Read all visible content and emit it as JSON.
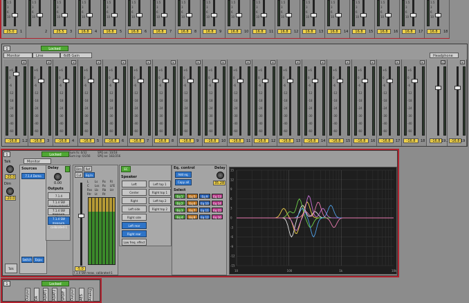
{
  "top_strip": {
    "values": [
      "25.0",
      "",
      "25.5",
      "16.8",
      "16.8",
      "16.8",
      "16.8",
      "16.8",
      "16.8",
      "16.8",
      "16.8",
      "16.8",
      "16.8",
      "16.8",
      "16.8",
      "16.8",
      "16.8",
      "16.8",
      "16.8"
    ],
    "channels": [
      "1",
      "2",
      "3",
      "4",
      "5",
      "6",
      "7",
      "8",
      "9",
      "10",
      "11",
      "12",
      "13",
      "14",
      "15",
      "16",
      "17",
      "18"
    ],
    "scale": [
      "1.5",
      "3",
      "6",
      "10"
    ]
  },
  "monitor_section": {
    "index": "1",
    "locked": "Locked",
    "tabs": [
      "Monitor",
      "Line",
      "6dB Gain"
    ],
    "headphone_tab": "Headphone",
    "mute_label": "M",
    "solo_label": "SD",
    "scale": [
      "+6",
      "0",
      "-6",
      "-12",
      "-18",
      "-24",
      "-30",
      "-40",
      "-60"
    ],
    "channel_values": [
      "-16.8",
      "-16.8",
      "-16.8",
      "-16.8",
      "-16.8",
      "-16.8",
      "-16.8",
      "-16.8",
      "-16.8",
      "-16.8",
      "-16.8",
      "-16.8",
      "-16.8",
      "-16.8",
      "-16.8",
      "-16.8",
      "-16.8"
    ],
    "channel_labels": [
      "1.2",
      "3",
      "4",
      "5",
      "6",
      "7",
      "8",
      "9",
      "10",
      "11",
      "12",
      "13",
      "14",
      "15",
      "16",
      "17",
      "18"
    ],
    "headphone_values": [
      "-16.8",
      "-16.8"
    ],
    "headphone_labels": [
      "19.20",
      "19"
    ]
  },
  "speaker_section": {
    "index": "1",
    "locked": "Locked",
    "sum_info_1": "Sum fx: 0/32",
    "sum_info_2": "Sum inp: 0/256",
    "spq_info_1": "SPQ on: 10/18",
    "spq_info_2": "SPQ av: 182/256",
    "monitor_tab": "Monitor",
    "talk": {
      "label": "Talk",
      "value": "-20.0",
      "button": "Talk"
    },
    "dim": {
      "label": "Dim",
      "value": "-20.0"
    },
    "sources": {
      "title": "Sources",
      "item": "7.1.4 Demo"
    },
    "delay_small": {
      "label": "Delay",
      "value": "0.00"
    },
    "outputs": {
      "title": "Outputs",
      "items": [
        "7.1.4",
        "7.1.4 SW measurement",
        "7.1.4 SW measure. calibrated",
        "7.1.4 SW measure. calibrated-1"
      ]
    },
    "switch_btn": "Switch",
    "expand_btn": "Exp⇔",
    "meter_head": [
      "Dim",
      "Ref",
      "Cut",
      "Eq.In"
    ],
    "meter_channels": [
      "L",
      "Ls",
      "Rs",
      "Rl",
      "C",
      "Lss",
      "Rs",
      "LFE",
      "Rss",
      "Lb",
      "Rb",
      "Ltr",
      "Rtr",
      "Lt",
      "Rt"
    ],
    "fader_value": "-5.0",
    "output_name": "7.1.4 SW meas. calibrated-1",
    "ec_label": "EC",
    "speaker": {
      "title": "Speaker",
      "left_col": [
        "Left",
        "Center",
        "Right",
        "Left side",
        "Right side",
        "Left rear",
        "Right rear",
        "Low freq. effect"
      ],
      "right_col": [
        "Left top 1",
        "Right top 1",
        "Left top 2",
        "Right top 2"
      ]
    },
    "eq_control": {
      "title": "Eq. control",
      "add": "Add eq.",
      "copy": "Copy all",
      "select": "Select"
    },
    "eq_buttons": [
      "Eq 1",
      "Eq 5",
      "Eq 9",
      "Eq 13",
      "Eq 2",
      "Eq 6",
      "Eq 10",
      "Eq 14",
      "Eq 3",
      "Eq 7",
      "Eq 11",
      "Eq 15",
      "Eq 4",
      "Eq 8",
      "Eq 12",
      "Eq 16"
    ],
    "eq_colors": [
      "#4b9a3a",
      "#c07a28",
      "#2d64b8",
      "#b73a8a",
      "#4b9a3a",
      "#c07a28",
      "#2d64b8",
      "#b73a8a",
      "#4b9a3a",
      "#c07a28",
      "#2d64b8",
      "#b73a8a",
      "#4b9a3a",
      "#c07a28",
      "#2d64b8",
      "#b73a8a"
    ],
    "delay": {
      "label": "Delay",
      "value": "35.28"
    },
    "graph": {
      "y_ticks": [
        "15",
        "12",
        "9",
        "6",
        "3",
        "0",
        "-3",
        "-6",
        "-9",
        "-12",
        "-15"
      ],
      "x_ticks": [
        "10",
        "100",
        "1k",
        "10k"
      ]
    }
  },
  "bottom_section": {
    "index": "1",
    "locked": "Locked",
    "labels": [
      "Output",
      "DA",
      "ADAT1",
      "ADAT2",
      "SPDIF",
      "Output",
      "AES",
      "Analog"
    ]
  }
}
